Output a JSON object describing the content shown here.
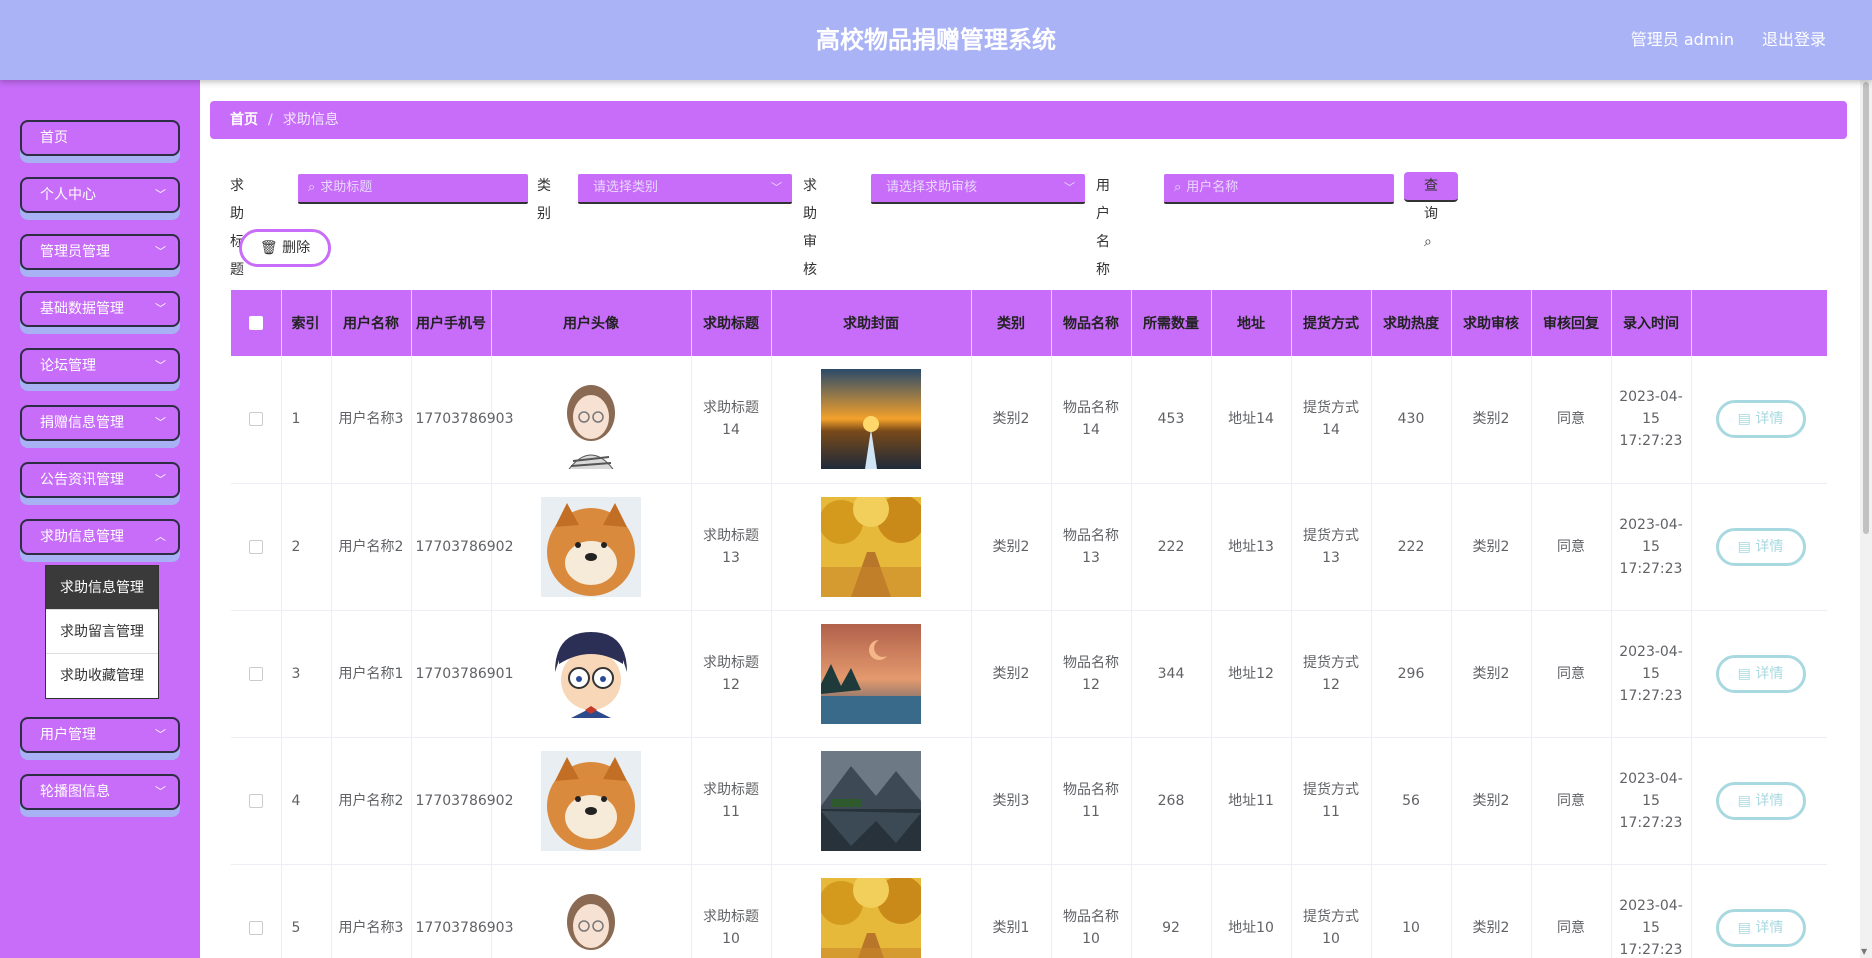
{
  "header": {
    "title": "高校物品捐赠管理系统",
    "admin_label": "管理员 admin",
    "logout_label": "退出登录"
  },
  "sidebar": {
    "items": [
      {
        "label": "首页",
        "has_arrow": false
      },
      {
        "label": "个人中心",
        "has_arrow": true
      },
      {
        "label": "管理员管理",
        "has_arrow": true
      },
      {
        "label": "基础数据管理",
        "has_arrow": true
      },
      {
        "label": "论坛管理",
        "has_arrow": true
      },
      {
        "label": "捐赠信息管理",
        "has_arrow": true
      },
      {
        "label": "公告资讯管理",
        "has_arrow": true
      },
      {
        "label": "求助信息管理",
        "has_arrow": true
      },
      {
        "label": "用户管理",
        "has_arrow": true
      },
      {
        "label": "轮播图信息",
        "has_arrow": true
      }
    ],
    "submenu": [
      {
        "label": "求助信息管理",
        "active": true
      },
      {
        "label": "求助留言管理",
        "active": false
      },
      {
        "label": "求助收藏管理",
        "active": false
      }
    ]
  },
  "breadcrumb": {
    "home": "首页",
    "separator": "/",
    "current": "求助信息"
  },
  "search": {
    "title_label": "求助标题",
    "title_placeholder": "求助标题",
    "category_label": "类别",
    "category_placeholder": "请选择类别",
    "audit_label": "求助审核",
    "audit_placeholder": "请选择求助审核",
    "user_label": "用户名称",
    "user_placeholder": "用户名称",
    "query_label": "查询"
  },
  "toolbar": {
    "delete_label": "删除"
  },
  "table": {
    "columns": [
      "索引",
      "用户名称",
      "用户手机号",
      "用户头像",
      "求助标题",
      "求助封面",
      "类别",
      "物品名称",
      "所需数量",
      "地址",
      "提货方式",
      "求助热度",
      "求助审核",
      "审核回复",
      "录入时间"
    ],
    "detail_label": "详情",
    "rows": [
      {
        "index": "1",
        "user": "用户名称3",
        "phone": "17703786903",
        "avatar": "girl-avatar",
        "title": "求助标题14",
        "cover": "sunset-road",
        "category": "类别2",
        "item": "物品名称14",
        "qty": "453",
        "addr": "地址14",
        "pickup": "提货方式14",
        "heat": "430",
        "audit": "类别2",
        "reply": "同意",
        "time": "2023-04-15 17:27:23"
      },
      {
        "index": "2",
        "user": "用户名称2",
        "phone": "17703786902",
        "avatar": "dog-avatar",
        "title": "求助标题13",
        "cover": "autumn-path",
        "category": "类别2",
        "item": "物品名称13",
        "qty": "222",
        "addr": "地址13",
        "pickup": "提货方式13",
        "heat": "222",
        "audit": "类别2",
        "reply": "同意",
        "time": "2023-04-15 17:27:23"
      },
      {
        "index": "3",
        "user": "用户名称1",
        "phone": "17703786901",
        "avatar": "boy-avatar",
        "title": "求助标题12",
        "cover": "moon-lake",
        "category": "类别2",
        "item": "物品名称12",
        "qty": "344",
        "addr": "地址12",
        "pickup": "提货方式12",
        "heat": "296",
        "audit": "类别2",
        "reply": "同意",
        "time": "2023-04-15 17:27:23"
      },
      {
        "index": "4",
        "user": "用户名称2",
        "phone": "17703786902",
        "avatar": "dog-avatar",
        "title": "求助标题11",
        "cover": "mountain-lake",
        "category": "类别3",
        "item": "物品名称11",
        "qty": "268",
        "addr": "地址11",
        "pickup": "提货方式11",
        "heat": "56",
        "audit": "类别2",
        "reply": "同意",
        "time": "2023-04-15 17:27:23"
      },
      {
        "index": "5",
        "user": "用户名称3",
        "phone": "17703786903",
        "avatar": "girl-avatar",
        "title": "求助标题10",
        "cover": "autumn-path",
        "category": "类别1",
        "item": "物品名称10",
        "qty": "92",
        "addr": "地址10",
        "pickup": "提货方式10",
        "heat": "10",
        "audit": "类别2",
        "reply": "同意",
        "time": "2023-04-15 17:27:23"
      }
    ]
  },
  "colors": {
    "header_bg": "#aab3f5",
    "accent": "#c76df9",
    "detail_border": "#a8d8e0"
  }
}
